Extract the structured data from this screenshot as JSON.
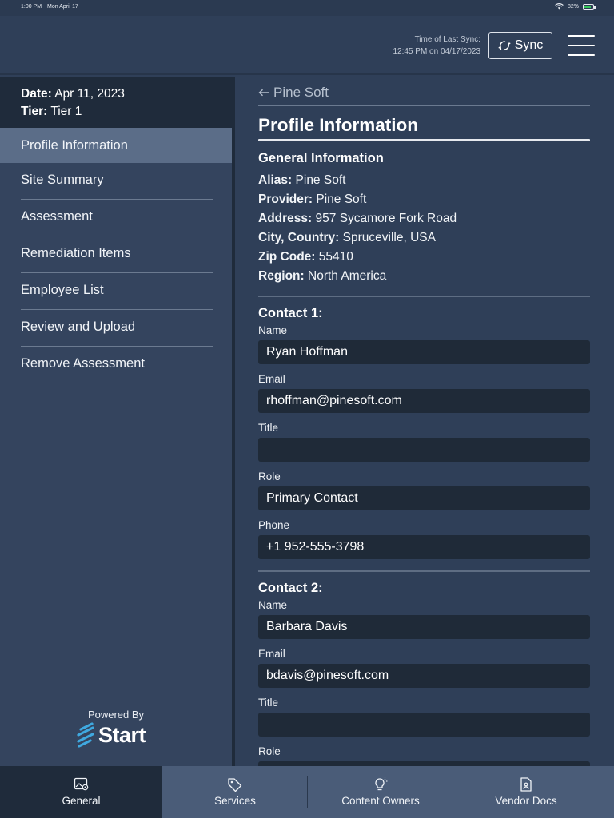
{
  "status_bar": {
    "time": "1:00 PM",
    "date": "Mon April 17",
    "battery": "82%",
    "battery_level": 0.82
  },
  "header": {
    "sync_label": "Time of Last Sync:",
    "sync_time": "12:45 PM on 04/17/2023",
    "sync_button": "Sync",
    "menu_icon": "hamburger-icon"
  },
  "sidebar": {
    "date_label": "Date:",
    "date_value": "Apr 11, 2023",
    "tier_label": "Tier:",
    "tier_value": "Tier 1",
    "items": [
      {
        "label": "Profile Information",
        "selected": true
      },
      {
        "label": "Site Summary"
      },
      {
        "label": "Assessment"
      },
      {
        "label": "Remediation Items"
      },
      {
        "label": "Employee List"
      },
      {
        "label": "Review and Upload"
      },
      {
        "label": "Remove Assessment"
      }
    ],
    "powered_by": "Powered By",
    "logo_text": "Start"
  },
  "main": {
    "back_label": "Pine Soft",
    "title": "Profile Information",
    "general": {
      "title": "General Information",
      "fields": [
        {
          "label": "Alias:",
          "value": "Pine Soft"
        },
        {
          "label": "Provider:",
          "value": "Pine Soft"
        },
        {
          "label": "Address:",
          "value": "957 Sycamore Fork Road"
        },
        {
          "label": "City, Country:",
          "value": "Spruceville, USA"
        },
        {
          "label": "Zip Code:",
          "value": "55410"
        },
        {
          "label": "Region:",
          "value": "North America"
        }
      ]
    },
    "contact1": {
      "title": "Contact 1:",
      "name_label": "Name",
      "name": "Ryan Hoffman",
      "email_label": "Email",
      "email": "rhoffman@pinesoft.com",
      "title_label": "Title",
      "title_value": "",
      "role_label": "Role",
      "role": "Primary Contact",
      "phone_label": "Phone",
      "phone": "+1 952-555-3798"
    },
    "contact2": {
      "title": "Contact 2:",
      "name_label": "Name",
      "name": "Barbara Davis",
      "email_label": "Email",
      "email": "bdavis@pinesoft.com",
      "title_label": "Title",
      "title_value": "",
      "role_label": "Role"
    }
  },
  "tabs": [
    {
      "label": "General",
      "icon": "gear-image-icon",
      "active": true
    },
    {
      "label": "Services",
      "icon": "tag-icon"
    },
    {
      "label": "Content Owners",
      "icon": "lightbulb-icon"
    },
    {
      "label": "Vendor Docs",
      "icon": "person-document-icon"
    }
  ],
  "colors": {
    "accent_dark": "#1f2b3b",
    "panel": "#2f3f58",
    "selected": "#5b6d88",
    "logo_blue": "#3fa9e0"
  }
}
